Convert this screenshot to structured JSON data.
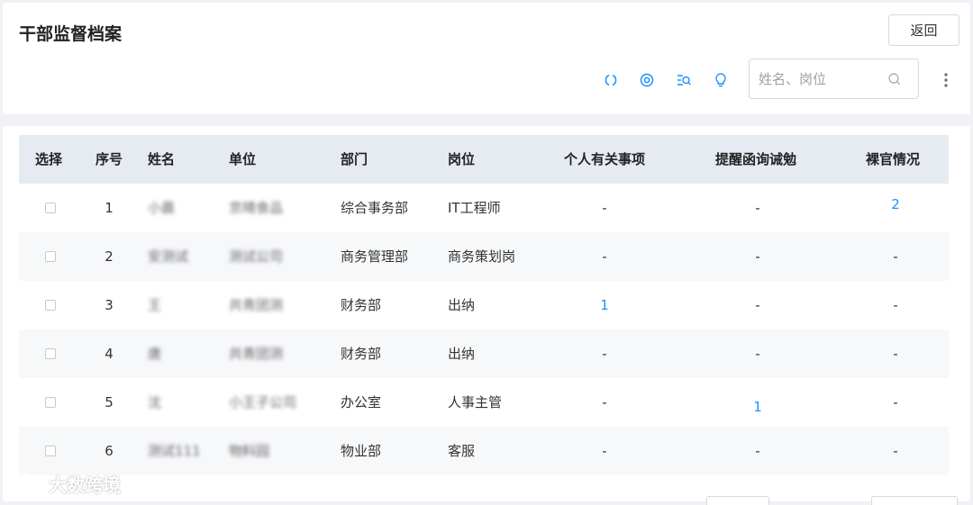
{
  "header": {
    "title": "干部监督档案",
    "back_label": "返回",
    "search_placeholder": "姓名、岗位",
    "tool_icons": [
      "refresh-icon",
      "settings-icon",
      "filter-search-icon",
      "lightbulb-icon"
    ]
  },
  "table": {
    "columns": [
      "选择",
      "序号",
      "姓名",
      "单位",
      "部门",
      "岗位",
      "个人有关事项",
      "提醒函询诫勉",
      "裸官情况"
    ],
    "rows": [
      {
        "index": "1",
        "name": "小晨",
        "unit": "京晴食品",
        "dept": "综合事务部",
        "post": "IT工程师",
        "personal": "-",
        "reminder": "-",
        "naked": "2"
      },
      {
        "index": "2",
        "name": "安测试",
        "unit": "测试公司",
        "dept": "商务管理部",
        "post": "商务策划岗",
        "personal": "-",
        "reminder": "-",
        "naked": "-"
      },
      {
        "index": "3",
        "name": "王",
        "unit": "共青团测",
        "dept": "财务部",
        "post": "出纳",
        "personal": "1",
        "reminder": "-",
        "naked": "-"
      },
      {
        "index": "4",
        "name": "唐",
        "unit": "共青团测",
        "dept": "财务部",
        "post": "出纳",
        "personal": "-",
        "reminder": "-",
        "naked": "-"
      },
      {
        "index": "5",
        "name": "沈",
        "unit": "小王子公司",
        "dept": "办公室",
        "post": "人事主管",
        "personal": "-",
        "reminder": "1",
        "naked": "-"
      },
      {
        "index": "6",
        "name": "测试111",
        "unit": "物料园",
        "dept": "物业部",
        "post": "客服",
        "personal": "-",
        "reminder": "-",
        "naked": "-"
      }
    ]
  },
  "watermark": {
    "text": "大数跨境"
  },
  "colors": {
    "accent": "#1890ff",
    "header_bg": "#e6ebf2",
    "alt_row": "#f7f8fa",
    "page_bg": "#f0f2f5"
  }
}
